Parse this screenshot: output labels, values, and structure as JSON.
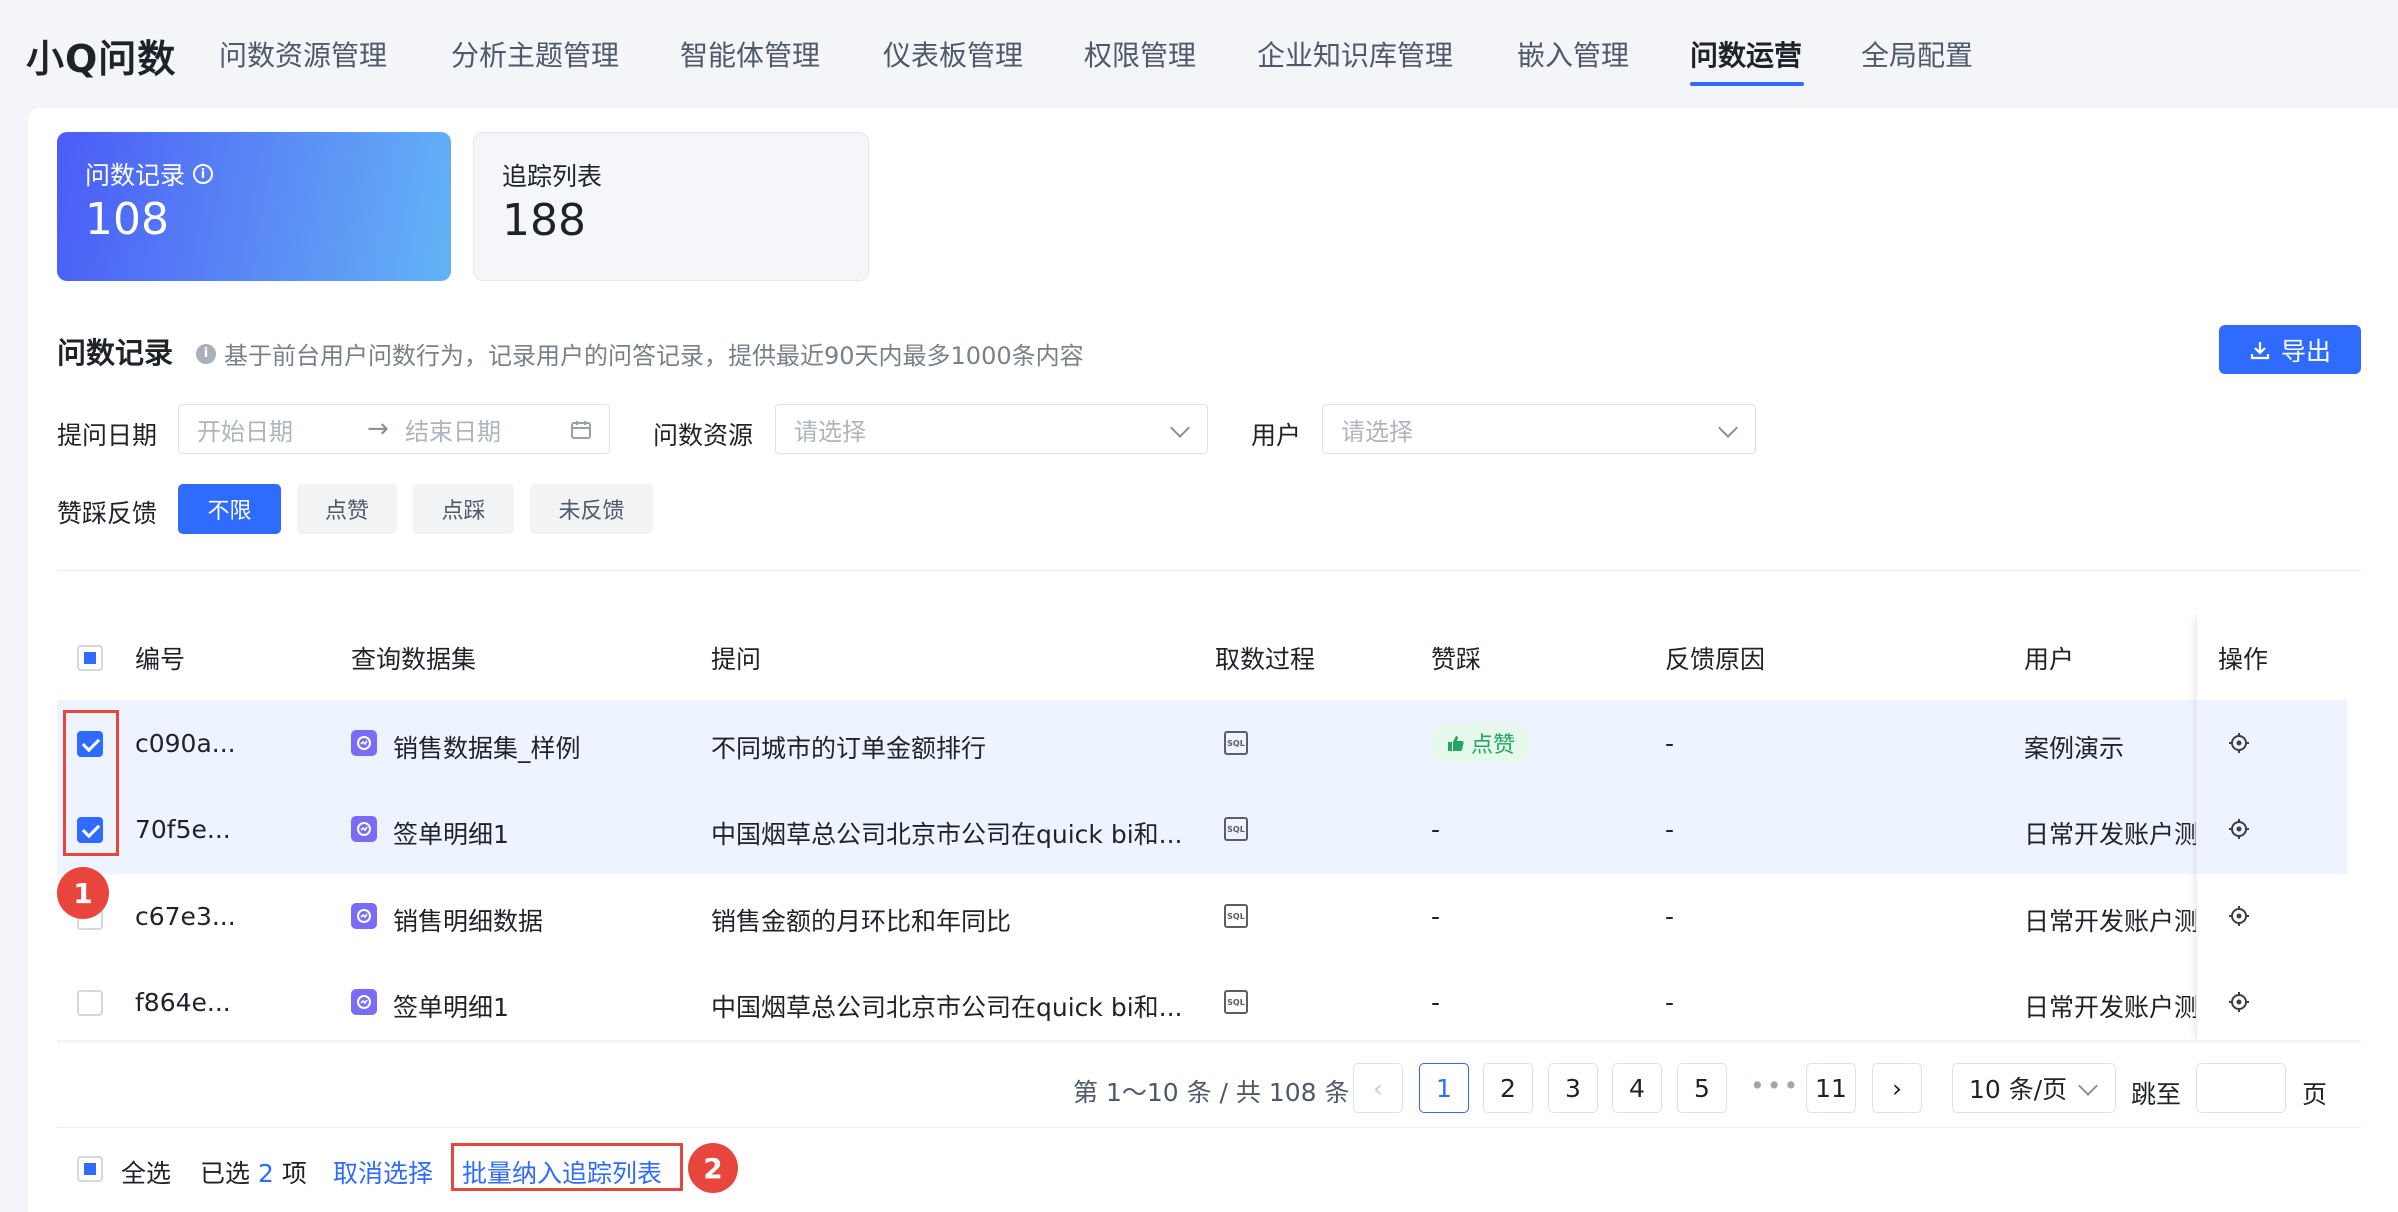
{
  "app": {
    "brand": "小Q问数"
  },
  "nav": [
    {
      "label": "问数资源管理"
    },
    {
      "label": "分析主题管理"
    },
    {
      "label": "智能体管理"
    },
    {
      "label": "仪表板管理"
    },
    {
      "label": "权限管理"
    },
    {
      "label": "企业知识库管理"
    },
    {
      "label": "嵌入管理"
    },
    {
      "label": "问数运营",
      "active": true
    },
    {
      "label": "全局配置"
    }
  ],
  "stats": [
    {
      "label": "问数记录",
      "value": "108",
      "active": true
    },
    {
      "label": "追踪列表",
      "value": "188"
    }
  ],
  "section": {
    "title": "问数记录",
    "desc": "基于前台用户问数行为，记录用户的问答记录，提供最近90天内最多1000条内容",
    "export_label": "导出"
  },
  "filters": {
    "date_label": "提问日期",
    "start_placeholder": "开始日期",
    "arrow": "→",
    "end_placeholder": "结束日期",
    "resource_label": "问数资源",
    "resource_placeholder": "请选择",
    "user_label": "用户",
    "user_placeholder": "请选择",
    "feedback_label": "赞踩反馈",
    "feedback_options": [
      "不限",
      "点赞",
      "点踩",
      "未反馈"
    ],
    "feedback_selected": "不限"
  },
  "table": {
    "columns": [
      "编号",
      "查询数据集",
      "提问",
      "取数过程",
      "赞踩",
      "反馈原因",
      "用户",
      "操作"
    ],
    "rows": [
      {
        "id": "c090a...",
        "dataset": "销售数据集_样例",
        "question": "不同城市的订单金额排行",
        "process": "SQL",
        "feedback": "点赞",
        "reason": "-",
        "user": "案例演示",
        "checked": true
      },
      {
        "id": "70f5e...",
        "dataset": "签单明细1",
        "question": "中国烟草总公司北京市公司在quick bi和...",
        "process": "SQL",
        "feedback": "-",
        "reason": "-",
        "user": "日常开发账户测",
        "checked": true
      },
      {
        "id": "c67e3...",
        "dataset": "销售明细数据",
        "question": "销售金额的月环比和年同比",
        "process": "SQL",
        "feedback": "-",
        "reason": "-",
        "user": "日常开发账户测",
        "checked": false
      },
      {
        "id": "f864e...",
        "dataset": "签单明细1",
        "question": "中国烟草总公司北京市公司在quick bi和...",
        "process": "SQL",
        "feedback": "-",
        "reason": "-",
        "user": "日常开发账户测",
        "checked": false
      }
    ]
  },
  "pagination": {
    "info": "第 1～10 条 / 共 108 条",
    "pages": [
      "1",
      "2",
      "3",
      "4",
      "5"
    ],
    "ellipsis": "•••",
    "last_page": "11",
    "current": "1",
    "page_size": "10 条/页",
    "jump_label": "跳至",
    "page_suffix": "页"
  },
  "bulk": {
    "select_all": "全选",
    "selected_prefix": "已选",
    "selected_count": "2",
    "selected_suffix": "项",
    "cancel": "取消选择",
    "batch_action": "批量纳入追踪列表"
  },
  "annotations": [
    "1",
    "2"
  ],
  "colors": {
    "accent": "#2f6bff",
    "annotation": "#e8453c",
    "like": "#21a663"
  }
}
